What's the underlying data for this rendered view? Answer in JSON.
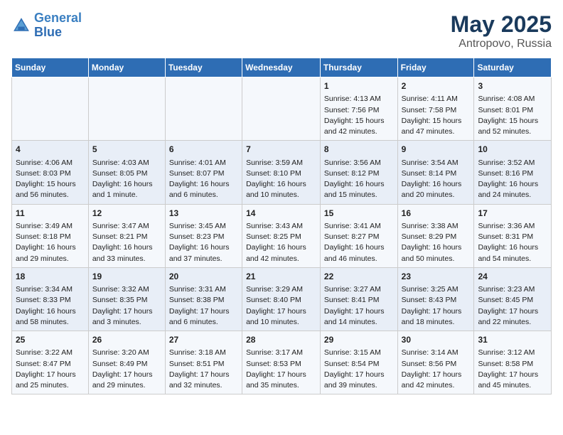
{
  "logo": {
    "line1": "General",
    "line2": "Blue"
  },
  "title": "May 2025",
  "subtitle": "Antropovo, Russia",
  "days_of_week": [
    "Sunday",
    "Monday",
    "Tuesday",
    "Wednesday",
    "Thursday",
    "Friday",
    "Saturday"
  ],
  "weeks": [
    [
      {
        "day": "",
        "content": ""
      },
      {
        "day": "",
        "content": ""
      },
      {
        "day": "",
        "content": ""
      },
      {
        "day": "",
        "content": ""
      },
      {
        "day": "1",
        "content": "Sunrise: 4:13 AM\nSunset: 7:56 PM\nDaylight: 15 hours and 42 minutes."
      },
      {
        "day": "2",
        "content": "Sunrise: 4:11 AM\nSunset: 7:58 PM\nDaylight: 15 hours and 47 minutes."
      },
      {
        "day": "3",
        "content": "Sunrise: 4:08 AM\nSunset: 8:01 PM\nDaylight: 15 hours and 52 minutes."
      }
    ],
    [
      {
        "day": "4",
        "content": "Sunrise: 4:06 AM\nSunset: 8:03 PM\nDaylight: 15 hours and 56 minutes."
      },
      {
        "day": "5",
        "content": "Sunrise: 4:03 AM\nSunset: 8:05 PM\nDaylight: 16 hours and 1 minute."
      },
      {
        "day": "6",
        "content": "Sunrise: 4:01 AM\nSunset: 8:07 PM\nDaylight: 16 hours and 6 minutes."
      },
      {
        "day": "7",
        "content": "Sunrise: 3:59 AM\nSunset: 8:10 PM\nDaylight: 16 hours and 10 minutes."
      },
      {
        "day": "8",
        "content": "Sunrise: 3:56 AM\nSunset: 8:12 PM\nDaylight: 16 hours and 15 minutes."
      },
      {
        "day": "9",
        "content": "Sunrise: 3:54 AM\nSunset: 8:14 PM\nDaylight: 16 hours and 20 minutes."
      },
      {
        "day": "10",
        "content": "Sunrise: 3:52 AM\nSunset: 8:16 PM\nDaylight: 16 hours and 24 minutes."
      }
    ],
    [
      {
        "day": "11",
        "content": "Sunrise: 3:49 AM\nSunset: 8:18 PM\nDaylight: 16 hours and 29 minutes."
      },
      {
        "day": "12",
        "content": "Sunrise: 3:47 AM\nSunset: 8:21 PM\nDaylight: 16 hours and 33 minutes."
      },
      {
        "day": "13",
        "content": "Sunrise: 3:45 AM\nSunset: 8:23 PM\nDaylight: 16 hours and 37 minutes."
      },
      {
        "day": "14",
        "content": "Sunrise: 3:43 AM\nSunset: 8:25 PM\nDaylight: 16 hours and 42 minutes."
      },
      {
        "day": "15",
        "content": "Sunrise: 3:41 AM\nSunset: 8:27 PM\nDaylight: 16 hours and 46 minutes."
      },
      {
        "day": "16",
        "content": "Sunrise: 3:38 AM\nSunset: 8:29 PM\nDaylight: 16 hours and 50 minutes."
      },
      {
        "day": "17",
        "content": "Sunrise: 3:36 AM\nSunset: 8:31 PM\nDaylight: 16 hours and 54 minutes."
      }
    ],
    [
      {
        "day": "18",
        "content": "Sunrise: 3:34 AM\nSunset: 8:33 PM\nDaylight: 16 hours and 58 minutes."
      },
      {
        "day": "19",
        "content": "Sunrise: 3:32 AM\nSunset: 8:35 PM\nDaylight: 17 hours and 3 minutes."
      },
      {
        "day": "20",
        "content": "Sunrise: 3:31 AM\nSunset: 8:38 PM\nDaylight: 17 hours and 6 minutes."
      },
      {
        "day": "21",
        "content": "Sunrise: 3:29 AM\nSunset: 8:40 PM\nDaylight: 17 hours and 10 minutes."
      },
      {
        "day": "22",
        "content": "Sunrise: 3:27 AM\nSunset: 8:41 PM\nDaylight: 17 hours and 14 minutes."
      },
      {
        "day": "23",
        "content": "Sunrise: 3:25 AM\nSunset: 8:43 PM\nDaylight: 17 hours and 18 minutes."
      },
      {
        "day": "24",
        "content": "Sunrise: 3:23 AM\nSunset: 8:45 PM\nDaylight: 17 hours and 22 minutes."
      }
    ],
    [
      {
        "day": "25",
        "content": "Sunrise: 3:22 AM\nSunset: 8:47 PM\nDaylight: 17 hours and 25 minutes."
      },
      {
        "day": "26",
        "content": "Sunrise: 3:20 AM\nSunset: 8:49 PM\nDaylight: 17 hours and 29 minutes."
      },
      {
        "day": "27",
        "content": "Sunrise: 3:18 AM\nSunset: 8:51 PM\nDaylight: 17 hours and 32 minutes."
      },
      {
        "day": "28",
        "content": "Sunrise: 3:17 AM\nSunset: 8:53 PM\nDaylight: 17 hours and 35 minutes."
      },
      {
        "day": "29",
        "content": "Sunrise: 3:15 AM\nSunset: 8:54 PM\nDaylight: 17 hours and 39 minutes."
      },
      {
        "day": "30",
        "content": "Sunrise: 3:14 AM\nSunset: 8:56 PM\nDaylight: 17 hours and 42 minutes."
      },
      {
        "day": "31",
        "content": "Sunrise: 3:12 AM\nSunset: 8:58 PM\nDaylight: 17 hours and 45 minutes."
      }
    ]
  ]
}
